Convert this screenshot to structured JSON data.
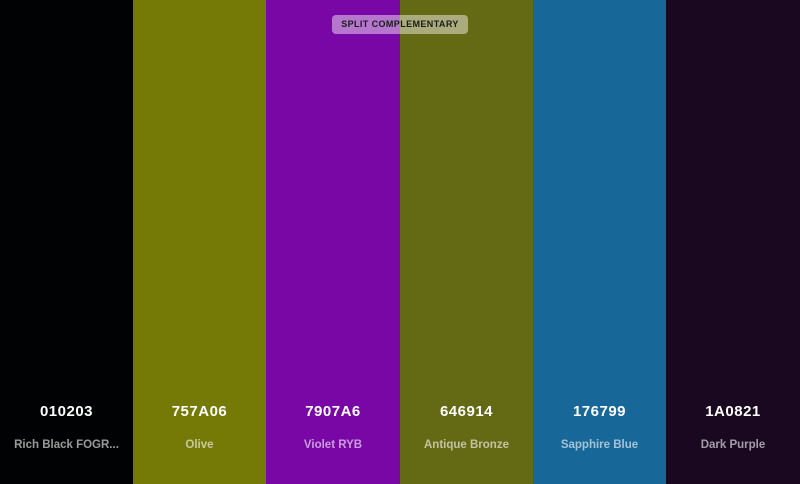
{
  "badge": "SPLIT COMPLEMENTARY",
  "colors": [
    {
      "hex": "010203",
      "name": "Rich Black FOGR...",
      "color": "#010203"
    },
    {
      "hex": "757A06",
      "name": "Olive",
      "color": "#757A06"
    },
    {
      "hex": "7907A6",
      "name": "Violet RYB",
      "color": "#7907A6"
    },
    {
      "hex": "646914",
      "name": "Antique Bronze",
      "color": "#646914"
    },
    {
      "hex": "176799",
      "name": "Sapphire Blue",
      "color": "#176799"
    },
    {
      "hex": "1A0821",
      "name": "Dark Purple",
      "color": "#1A0821"
    }
  ]
}
